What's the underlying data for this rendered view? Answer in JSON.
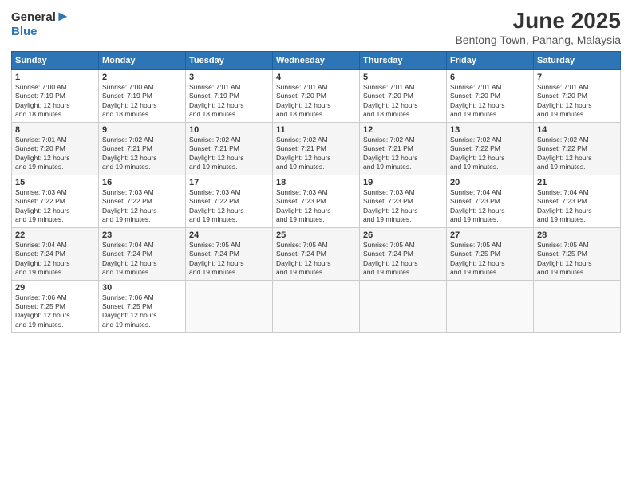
{
  "header": {
    "logo_general": "General",
    "logo_blue": "Blue",
    "main_title": "June 2025",
    "subtitle": "Bentong Town, Pahang, Malaysia"
  },
  "days_of_week": [
    "Sunday",
    "Monday",
    "Tuesday",
    "Wednesday",
    "Thursday",
    "Friday",
    "Saturday"
  ],
  "weeks": [
    [
      {
        "day": "1",
        "sunrise": "7:00 AM",
        "sunset": "7:19 PM",
        "daylight": "12 hours and 18 minutes."
      },
      {
        "day": "2",
        "sunrise": "7:00 AM",
        "sunset": "7:19 PM",
        "daylight": "12 hours and 18 minutes."
      },
      {
        "day": "3",
        "sunrise": "7:01 AM",
        "sunset": "7:19 PM",
        "daylight": "12 hours and 18 minutes."
      },
      {
        "day": "4",
        "sunrise": "7:01 AM",
        "sunset": "7:20 PM",
        "daylight": "12 hours and 18 minutes."
      },
      {
        "day": "5",
        "sunrise": "7:01 AM",
        "sunset": "7:20 PM",
        "daylight": "12 hours and 18 minutes."
      },
      {
        "day": "6",
        "sunrise": "7:01 AM",
        "sunset": "7:20 PM",
        "daylight": "12 hours and 19 minutes."
      },
      {
        "day": "7",
        "sunrise": "7:01 AM",
        "sunset": "7:20 PM",
        "daylight": "12 hours and 19 minutes."
      }
    ],
    [
      {
        "day": "8",
        "sunrise": "7:01 AM",
        "sunset": "7:20 PM",
        "daylight": "12 hours and 19 minutes."
      },
      {
        "day": "9",
        "sunrise": "7:02 AM",
        "sunset": "7:21 PM",
        "daylight": "12 hours and 19 minutes."
      },
      {
        "day": "10",
        "sunrise": "7:02 AM",
        "sunset": "7:21 PM",
        "daylight": "12 hours and 19 minutes."
      },
      {
        "day": "11",
        "sunrise": "7:02 AM",
        "sunset": "7:21 PM",
        "daylight": "12 hours and 19 minutes."
      },
      {
        "day": "12",
        "sunrise": "7:02 AM",
        "sunset": "7:21 PM",
        "daylight": "12 hours and 19 minutes."
      },
      {
        "day": "13",
        "sunrise": "7:02 AM",
        "sunset": "7:22 PM",
        "daylight": "12 hours and 19 minutes."
      },
      {
        "day": "14",
        "sunrise": "7:02 AM",
        "sunset": "7:22 PM",
        "daylight": "12 hours and 19 minutes."
      }
    ],
    [
      {
        "day": "15",
        "sunrise": "7:03 AM",
        "sunset": "7:22 PM",
        "daylight": "12 hours and 19 minutes."
      },
      {
        "day": "16",
        "sunrise": "7:03 AM",
        "sunset": "7:22 PM",
        "daylight": "12 hours and 19 minutes."
      },
      {
        "day": "17",
        "sunrise": "7:03 AM",
        "sunset": "7:22 PM",
        "daylight": "12 hours and 19 minutes."
      },
      {
        "day": "18",
        "sunrise": "7:03 AM",
        "sunset": "7:23 PM",
        "daylight": "12 hours and 19 minutes."
      },
      {
        "day": "19",
        "sunrise": "7:03 AM",
        "sunset": "7:23 PM",
        "daylight": "12 hours and 19 minutes."
      },
      {
        "day": "20",
        "sunrise": "7:04 AM",
        "sunset": "7:23 PM",
        "daylight": "12 hours and 19 minutes."
      },
      {
        "day": "21",
        "sunrise": "7:04 AM",
        "sunset": "7:23 PM",
        "daylight": "12 hours and 19 minutes."
      }
    ],
    [
      {
        "day": "22",
        "sunrise": "7:04 AM",
        "sunset": "7:24 PM",
        "daylight": "12 hours and 19 minutes."
      },
      {
        "day": "23",
        "sunrise": "7:04 AM",
        "sunset": "7:24 PM",
        "daylight": "12 hours and 19 minutes."
      },
      {
        "day": "24",
        "sunrise": "7:05 AM",
        "sunset": "7:24 PM",
        "daylight": "12 hours and 19 minutes."
      },
      {
        "day": "25",
        "sunrise": "7:05 AM",
        "sunset": "7:24 PM",
        "daylight": "12 hours and 19 minutes."
      },
      {
        "day": "26",
        "sunrise": "7:05 AM",
        "sunset": "7:24 PM",
        "daylight": "12 hours and 19 minutes."
      },
      {
        "day": "27",
        "sunrise": "7:05 AM",
        "sunset": "7:25 PM",
        "daylight": "12 hours and 19 minutes."
      },
      {
        "day": "28",
        "sunrise": "7:05 AM",
        "sunset": "7:25 PM",
        "daylight": "12 hours and 19 minutes."
      }
    ],
    [
      {
        "day": "29",
        "sunrise": "7:06 AM",
        "sunset": "7:25 PM",
        "daylight": "12 hours and 19 minutes."
      },
      {
        "day": "30",
        "sunrise": "7:06 AM",
        "sunset": "7:25 PM",
        "daylight": "12 hours and 19 minutes."
      },
      null,
      null,
      null,
      null,
      null
    ]
  ],
  "labels": {
    "sunrise": "Sunrise: ",
    "sunset": "Sunset: ",
    "daylight": "Daylight: "
  }
}
